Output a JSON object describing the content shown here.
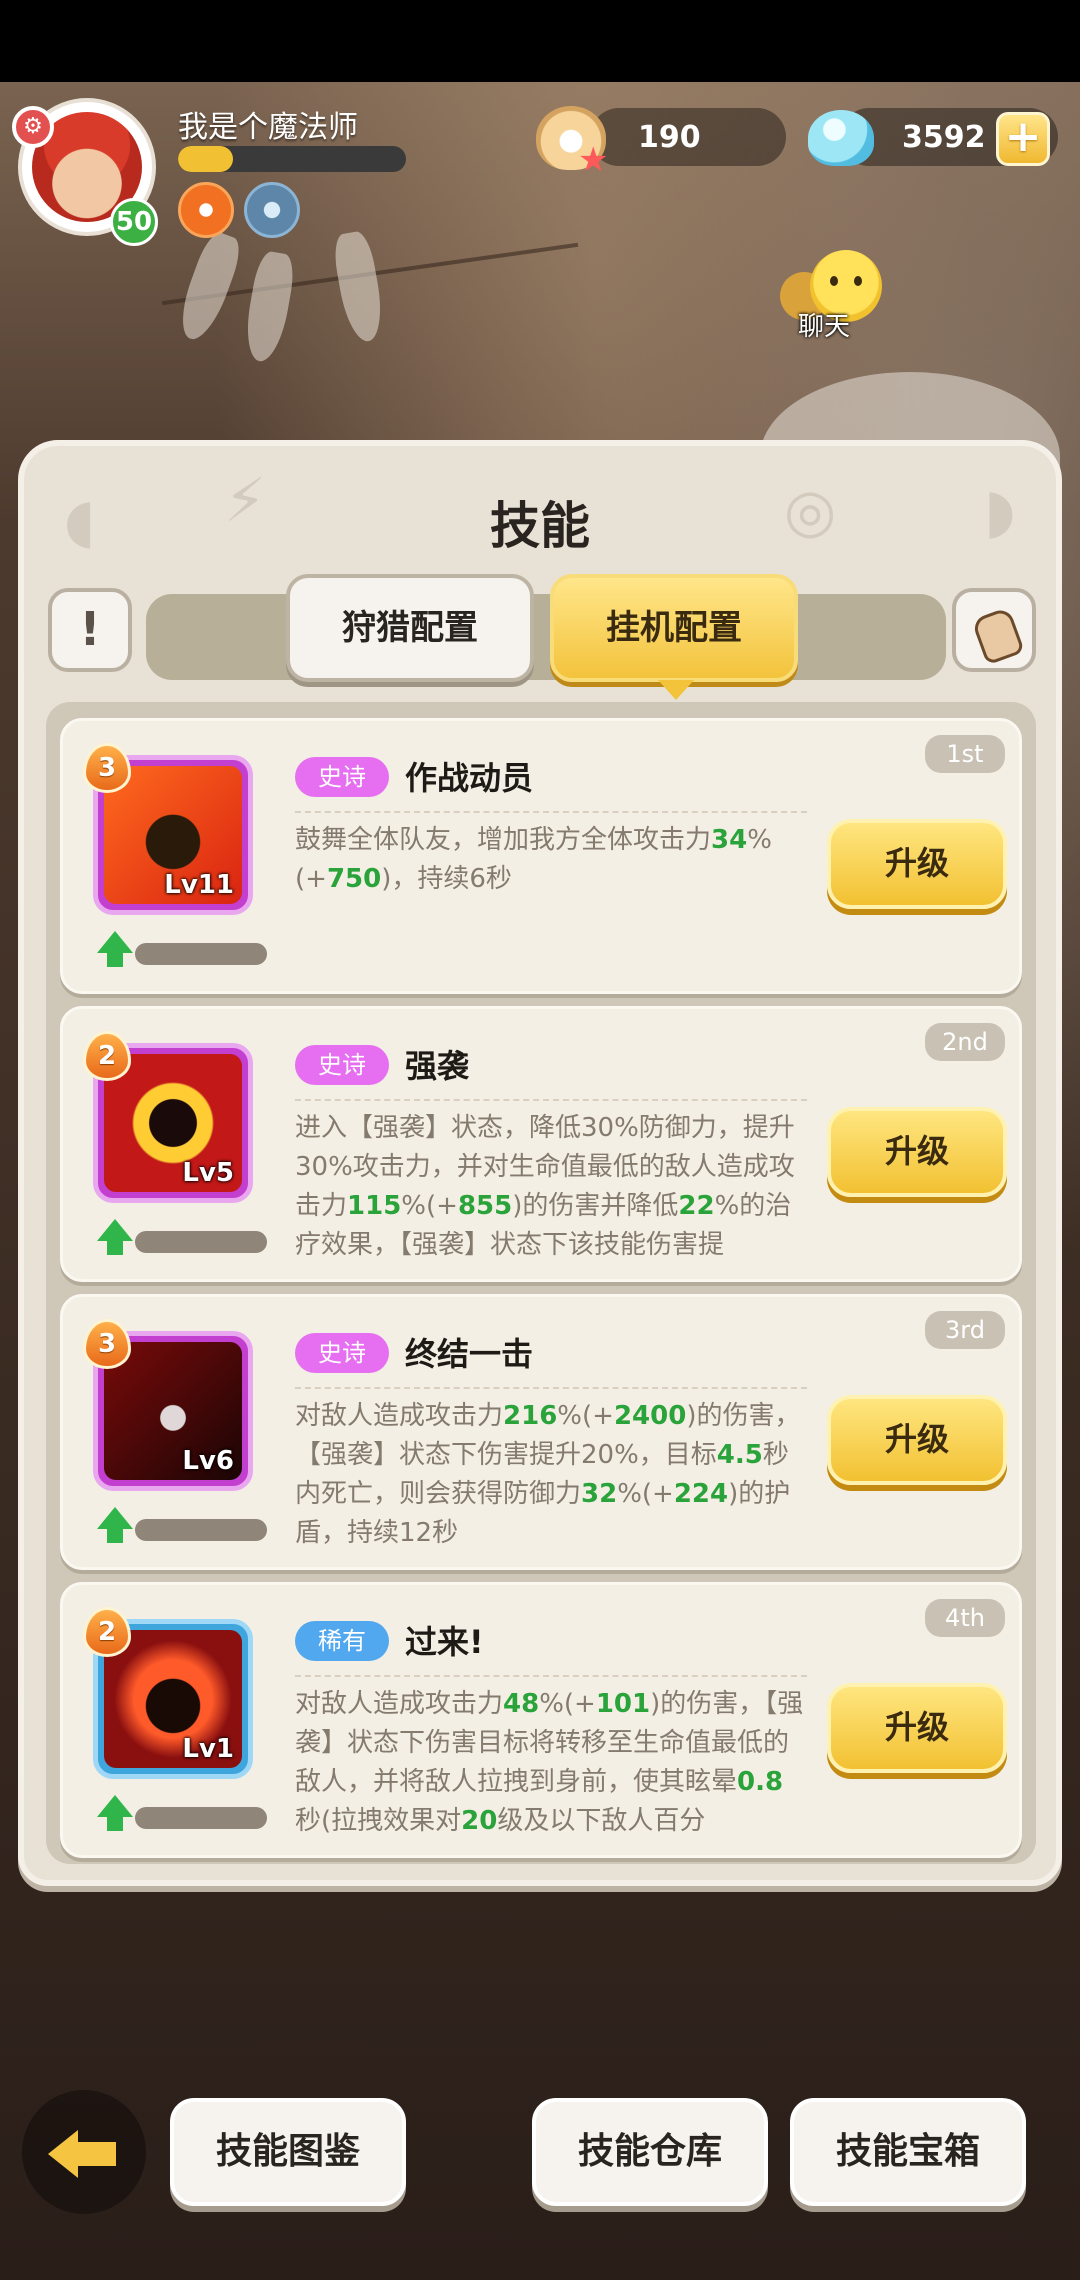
{
  "player": {
    "name": "我是个魔法师",
    "level": "50",
    "xp_progress": 0.24
  },
  "resources": {
    "pearls": "190",
    "gems": "3592"
  },
  "chat": {
    "label": "聊天"
  },
  "panel": {
    "title": "技能",
    "info_label": "!",
    "tabs": [
      {
        "label": "狩猎配置",
        "active": false
      },
      {
        "label": "挂机配置",
        "active": true
      }
    ]
  },
  "skills": [
    {
      "rank": "1st",
      "rarity": "史诗",
      "name": "作战动员",
      "stars": "3",
      "level": "Lv11",
      "desc_html": "鼓舞全体队友，增加我方全体攻击力<span class=\"g\">34</span>%(+<span class=\"g\">750</span>)，持续6秒",
      "upgrade_label": "升级"
    },
    {
      "rank": "2nd",
      "rarity": "史诗",
      "name": "强袭",
      "stars": "2",
      "level": "Lv5",
      "desc_html": "进入【强袭】状态，降低30%防御力，提升30%攻击力，并对生命值最低的敌人造成攻击力<span class=\"g\">115</span>%(+<span class=\"g\">855</span>)的伤害并降低<span class=\"g\">22</span>%的治疗效果，【强袭】状态下该技能伤害提",
      "upgrade_label": "升级"
    },
    {
      "rank": "3rd",
      "rarity": "史诗",
      "name": "终结一击",
      "stars": "3",
      "level": "Lv6",
      "desc_html": "对敌人造成攻击力<span class=\"g\">216</span>%(+<span class=\"g\">2400</span>)的伤害，【强袭】状态下伤害提升20%，目标<span class=\"g\">4.5</span>秒内死亡，则会获得防御力<span class=\"g\">32</span>%(+<span class=\"g\">224</span>)的护盾，持续12秒",
      "upgrade_label": "升级"
    },
    {
      "rank": "4th",
      "rarity": "稀有",
      "name": "过来!",
      "stars": "2",
      "level": "Lv1",
      "desc_html": "对敌人造成攻击力<span class=\"g\">48</span>%(+<span class=\"g\">101</span>)的伤害，【强袭】状态下伤害目标将转移至生命值最低的敌人，并将敌人拉拽到身前，使其眩晕<span class=\"g\">0.8</span>秒(拉拽效果对<span class=\"g\">20</span>级及以下敌人百分",
      "upgrade_label": "升级"
    }
  ],
  "bottom_nav": {
    "codex": "技能图鉴",
    "storage": "技能仓库",
    "chest": "技能宝箱"
  }
}
